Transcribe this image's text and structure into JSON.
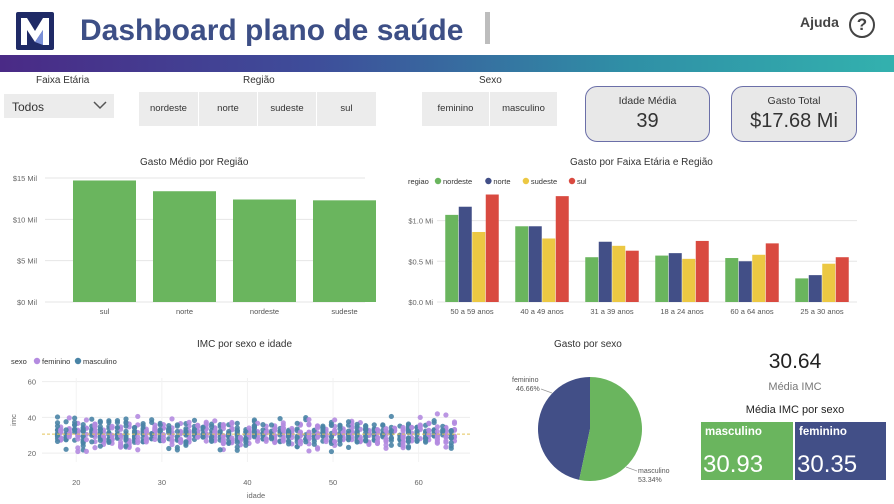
{
  "header": {
    "title": "Dashboard plano de saúde",
    "help_label": "Ajuda",
    "help_icon": "question-circle-icon",
    "logo_icon": "m-logo-icon"
  },
  "colors": {
    "nordeste": "#6ab55e",
    "norte": "#424f87",
    "sudeste": "#ecc843",
    "sul": "#d94a40",
    "feminino": "#b48be0",
    "masculino": "#4a84a6",
    "male_tile": "#6ab55e",
    "female_tile": "#424f87"
  },
  "filters": {
    "faixa_etaria": {
      "label": "Faixa Etária",
      "value": "Todos"
    },
    "regiao": {
      "label": "Região",
      "options": [
        "nordeste",
        "norte",
        "sudeste",
        "sul"
      ]
    },
    "sexo": {
      "label": "Sexo",
      "options": [
        "feminino",
        "masculino"
      ]
    }
  },
  "kpis": {
    "idade_media": {
      "label": "Idade Média",
      "value": "39"
    },
    "gasto_total": {
      "label": "Gasto Total",
      "value": "$17.68 Mi"
    }
  },
  "imc": {
    "value": "30.64",
    "label": "Média IMC",
    "by_sex_title": "Média IMC por sexo",
    "tiles": [
      {
        "label": "masculino",
        "value": "30.93"
      },
      {
        "label": "feminino",
        "value": "30.35"
      }
    ]
  },
  "chart_data": [
    {
      "type": "bar",
      "title": "Gasto Médio por Região",
      "categories": [
        "sul",
        "norte",
        "nordeste",
        "sudeste"
      ],
      "values": [
        14.7,
        13.4,
        12.4,
        12.3
      ],
      "yticks": [
        "$0 Mil",
        "$5 Mil",
        "$10 Mil",
        "$15 Mil"
      ],
      "ylim": [
        0,
        15
      ],
      "grid": true
    },
    {
      "type": "bar",
      "title": "Gasto por Faixa Etária e Região",
      "legend_title": "regiao",
      "legend_position": "top-left",
      "categories": [
        "50 a 59 anos",
        "40 a 49 anos",
        "31 a 39 anos",
        "18 a 24 anos",
        "60 a 64 anos",
        "25 a 30 anos"
      ],
      "series": [
        {
          "name": "nordeste",
          "values": [
            1.07,
            0.93,
            0.55,
            0.57,
            0.54,
            0.29
          ]
        },
        {
          "name": "norte",
          "values": [
            1.17,
            0.93,
            0.74,
            0.6,
            0.5,
            0.33
          ]
        },
        {
          "name": "sudeste",
          "values": [
            0.86,
            0.78,
            0.69,
            0.53,
            0.58,
            0.47
          ]
        },
        {
          "name": "sul",
          "values": [
            1.32,
            1.3,
            0.63,
            0.75,
            0.72,
            0.55
          ]
        }
      ],
      "yticks": [
        "$0.0 Mi",
        "$0.5 Mi",
        "$1.0 Mi"
      ],
      "ylim": [
        0,
        1.4
      ],
      "grid": true
    },
    {
      "type": "scatter",
      "title": "IMC por sexo e idade",
      "legend_title": "sexo",
      "legend_position": "top-left",
      "series_names": [
        "feminino",
        "masculino"
      ],
      "xlabel": "idade",
      "ylabel": "imc",
      "xticks": [
        20,
        30,
        40,
        50,
        60
      ],
      "yticks": [
        20,
        40,
        60
      ],
      "xlim": [
        16,
        66
      ],
      "ylim": [
        15,
        62
      ],
      "age_range": [
        18,
        64
      ],
      "imc_center": 30.6
    },
    {
      "type": "pie",
      "title": "Gasto por sexo",
      "labels": [
        "feminino",
        "masculino"
      ],
      "values": [
        46.66,
        53.34
      ],
      "label_texts": [
        "46.66%",
        "53.34%"
      ]
    }
  ]
}
